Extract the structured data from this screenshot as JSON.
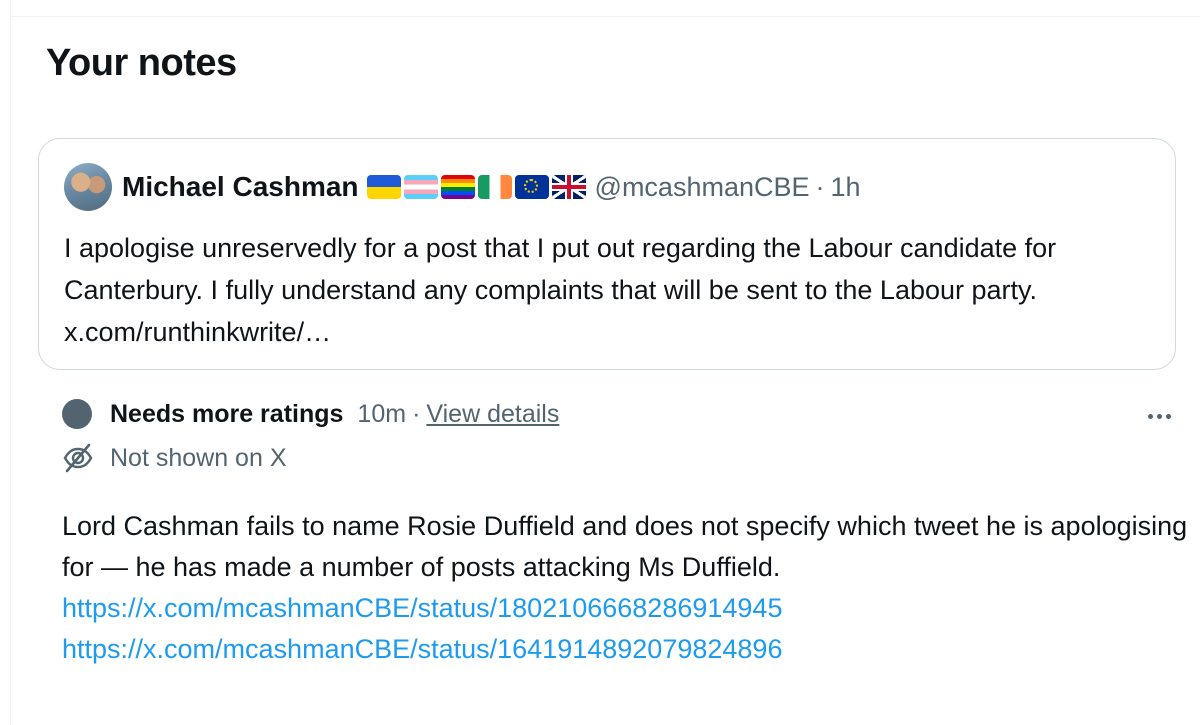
{
  "page": {
    "title": "Your notes"
  },
  "post": {
    "author_name": "Michael Cashman",
    "flags": [
      "ukraine-flag",
      "transgender-flag",
      "rainbow-flag",
      "ireland-flag",
      "eu-flag",
      "uk-flag"
    ],
    "handle": "@mcashmanCBE",
    "separator": "·",
    "time": "1h",
    "text": "I apologise unreservedly for a post that I put out regarding the Labour candidate for Canterbury. I fully understand any complaints that will be sent to the Labour party. x.com/runthinkwrite/…"
  },
  "note": {
    "status": "Needs more ratings",
    "time": "10m",
    "separator": "·",
    "view_details": "View details",
    "more_icon": "more-horizontal-icon",
    "visibility_icon": "eye-off-icon",
    "visibility": "Not shown on X",
    "text": "Lord Cashman fails to name Rosie Duffield and does not specify which tweet he is apologising for — he has made a number of posts attacking Ms Duffield.",
    "links": [
      "https://x.com/mcashmanCBE/status/1802106668286914945",
      "https://x.com/mcashmanCBE/status/1641914892079824896"
    ]
  },
  "colors": {
    "text_primary": "#0f1419",
    "text_secondary": "#536471",
    "link": "#1d9bf0",
    "border": "#cfd9de",
    "status_dot": "#536471"
  }
}
